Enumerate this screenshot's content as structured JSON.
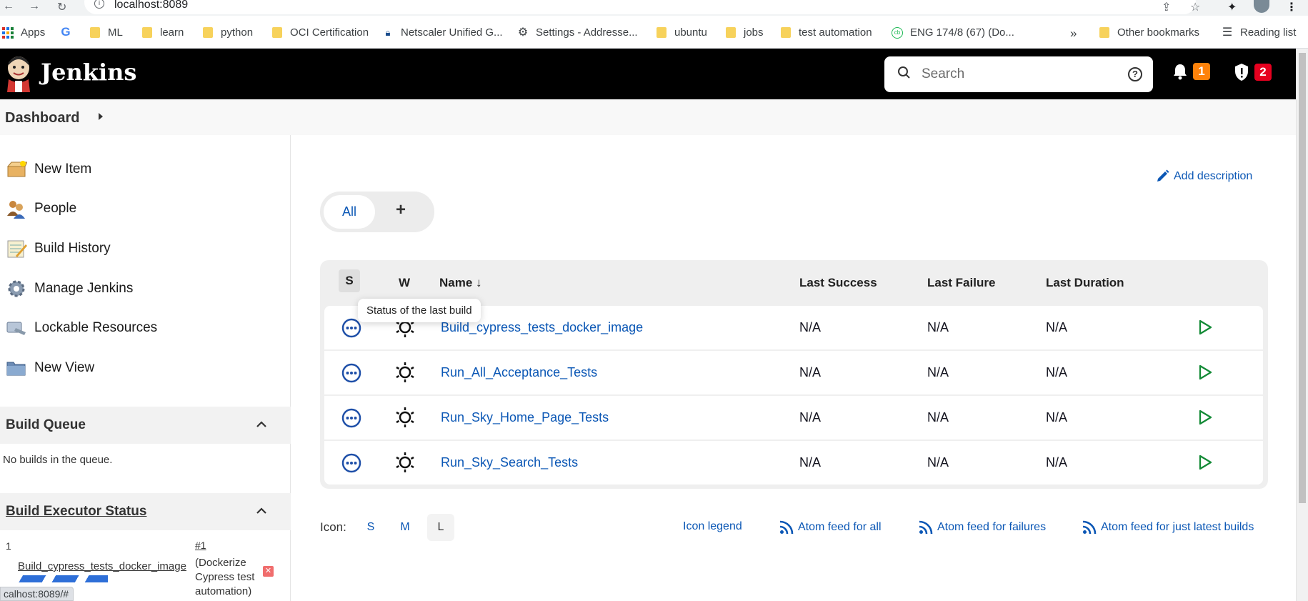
{
  "browser": {
    "url": "localhost:8089",
    "bookmarks": [
      {
        "label": "Apps",
        "icon": "apps-icon"
      },
      {
        "label": "",
        "icon": "google-icon"
      },
      {
        "label": "ML",
        "icon": "folder-icon"
      },
      {
        "label": "learn",
        "icon": "folder-icon"
      },
      {
        "label": "python",
        "icon": "folder-icon"
      },
      {
        "label": "OCI Certification",
        "icon": "folder-icon"
      },
      {
        "label": "Netscaler Unified G...",
        "icon": "lock-icon"
      },
      {
        "label": "Settings - Addresse...",
        "icon": "gear-icon"
      },
      {
        "label": "ubuntu",
        "icon": "folder-icon"
      },
      {
        "label": "jobs",
        "icon": "folder-icon"
      },
      {
        "label": "test automation",
        "icon": "folder-icon"
      },
      {
        "label": "ENG 174/8 (67) (Do...",
        "icon": "cb-icon"
      }
    ],
    "more_label": "»",
    "other_bookmarks": "Other bookmarks",
    "reading_list": "Reading list",
    "status_url": "calhost:8089/#"
  },
  "header": {
    "title": "Jenkins",
    "search_placeholder": "Search",
    "notifications_count": "1",
    "security_count": "2",
    "colors": {
      "bg": "#000000",
      "notif": "#fe820a",
      "security": "#e6001f"
    }
  },
  "breadcrumb": {
    "label": "Dashboard"
  },
  "sidebar": {
    "tasks": [
      {
        "label": "New Item",
        "icon": "new-item-icon"
      },
      {
        "label": "People",
        "icon": "people-icon"
      },
      {
        "label": "Build History",
        "icon": "build-history-icon"
      },
      {
        "label": "Manage Jenkins",
        "icon": "gear-icon"
      },
      {
        "label": "Lockable Resources",
        "icon": "lockable-resources-icon"
      },
      {
        "label": "New View",
        "icon": "folder-icon"
      }
    ],
    "build_queue": {
      "title": "Build Queue",
      "empty_text": "No builds in the queue."
    },
    "executors": {
      "title": "Build Executor Status",
      "number": "1",
      "job": "Build_cypress_tests_docker_image",
      "build": "#1",
      "description": "(Dockerize Cypress test automation)"
    }
  },
  "main": {
    "add_description": "Add description",
    "tabs": {
      "all": "All",
      "add": "+"
    },
    "table": {
      "columns": {
        "s": "S",
        "w": "W",
        "name": "Name ↓",
        "last_success": "Last Success",
        "last_failure": "Last Failure",
        "last_duration": "Last Duration"
      },
      "rows": [
        {
          "name": "Build_cypress_tests_docker_image",
          "last_success": "N/A",
          "last_failure": "N/A",
          "last_duration": "N/A"
        },
        {
          "name": "Run_All_Acceptance_Tests",
          "last_success": "N/A",
          "last_failure": "N/A",
          "last_duration": "N/A"
        },
        {
          "name": "Run_Sky_Home_Page_Tests",
          "last_success": "N/A",
          "last_failure": "N/A",
          "last_duration": "N/A"
        },
        {
          "name": "Run_Sky_Search_Tests",
          "last_success": "N/A",
          "last_failure": "N/A",
          "last_duration": "N/A"
        }
      ]
    },
    "tooltip": "Status of the last build",
    "footer": {
      "icon_label": "Icon:",
      "sizes": [
        "S",
        "M",
        "L"
      ],
      "icon_legend": "Icon legend",
      "atom_all": "Atom feed for all",
      "atom_failures": "Atom feed for failures",
      "atom_latest": "Atom feed for just latest builds"
    }
  }
}
